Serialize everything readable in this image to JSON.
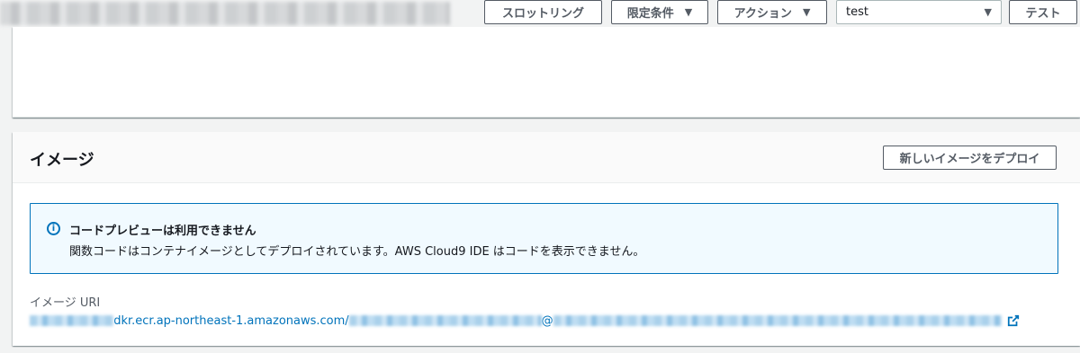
{
  "header": {
    "slot_button": "スロットリング",
    "limit_button": "限定条件",
    "action_button": "アクション",
    "caret": "▼",
    "test_select_value": "test",
    "test_button": "テスト"
  },
  "image_panel": {
    "title": "イメージ",
    "deploy_button": "新しいイメージをデプロイ",
    "alert": {
      "icon": "info-icon",
      "icon_glyph": "i",
      "title": "コードプレビューは利用できません",
      "body": "関数コードはコンテナイメージとしてデプロイされています。AWS Cloud9 IDE はコードを表示できません。"
    },
    "uri_label": "イメージ URI",
    "uri": {
      "visible_part": "dkr.ecr.ap-northeast-1.amazonaws.com/",
      "at_sign": "@",
      "external_link_icon": "external-link-icon"
    }
  },
  "colors": {
    "link": "#0073bb",
    "info_bg": "#f1faff",
    "info_border": "#0073bb",
    "page_bg": "#f2f3f3"
  }
}
